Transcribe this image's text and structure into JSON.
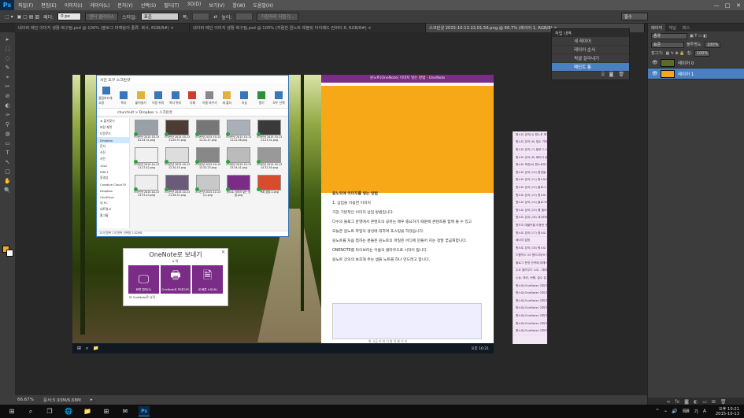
{
  "app": {
    "logo": "Ps"
  },
  "menu": [
    "파일(F)",
    "편집(E)",
    "이미지(I)",
    "레이어(L)",
    "문자(Y)",
    "선택(S)",
    "필터(T)",
    "3D(D)",
    "보기(V)",
    "창(W)",
    "도움말(H)"
  ],
  "window_controls": {
    "minimize": "—",
    "maximize": "□",
    "close": "✕"
  },
  "options": {
    "feather_label": "페더:",
    "feather_value": "0 px",
    "antialias_label": "앤티 앨리어스",
    "style_label": "스타일:",
    "style_value": "표준",
    "width_label": "폭:",
    "height_label": "높이:",
    "refine_button": "가장자리 다듬기...",
    "workspace": "필수"
  },
  "doc_tabs": [
    "네이버 메인 이미지 생활-복구됨.psd @ 100% (블로그 마케팅의 종류. 복사, RGB/8#) ×",
    "네이버 메인 이미지 생활-복구됨.psd @ 100% (저렴한 원노트 태블릿 아이패드 컨버터 8, RGB/8#) ×",
    "스크린샷 2015-10-13 22.01.56.png @ 66.7% (레이어 1, RGB/8) ×"
  ],
  "tools": [
    "▸",
    "⬚",
    "◌",
    "✎",
    "⌖",
    "✂",
    "⊘",
    "◐",
    "✑",
    "⚲",
    "◍",
    "▭",
    "T",
    "↖",
    "▢",
    "✋",
    "🔍"
  ],
  "history": {
    "title": "작업 내역",
    "items": [
      "새 레이어",
      "레이어 순서",
      "픽셀 잘라내기",
      "페인트 통"
    ],
    "selected": 3
  },
  "layers_panel": {
    "tabs": [
      "레이어",
      "채널",
      "패스"
    ],
    "kind_label": "종류",
    "blend_mode": "표준",
    "opacity_label": "불투명도:",
    "opacity_value": "100%",
    "lock_label": "잠그기:",
    "fill_label": "칠:",
    "fill_value": "100%",
    "layers": [
      {
        "name": "레이어 0",
        "thumb_color": "#5a6b2c",
        "selected": false
      },
      {
        "name": "레이어 1",
        "thumb_color": "#f7a817",
        "selected": true
      }
    ]
  },
  "explorer": {
    "title": "사진 도구   스크린샷",
    "ribbon": [
      "클립보드에 고정",
      "복사",
      "붙여넣기",
      "이동 위치",
      "복사 위치",
      "삭제",
      "이름 바꾸기",
      "새 폴더",
      "속성",
      "열기",
      "모두 선택"
    ],
    "address": "churchult > Dropbox > 스크린샷",
    "nav": [
      "★ 즐겨찾기",
      "바탕 화면",
      "다운로드",
      "Dropbox",
      "문서",
      "사진",
      "사진",
      "10s2",
      "WRL1",
      "동영상",
      "Creative Cloud Fil",
      "Dropbox",
      "OneDrive",
      "내 PC",
      "네트워크",
      "홈그룹"
    ],
    "files": [
      {
        "name": "스크린샷 2015-10-13 01.24.31.png",
        "color": "#9aa0a8"
      },
      {
        "name": "스크린샷 2015-10-13 11.09.37.png",
        "color": "#4c3c34"
      },
      {
        "name": "스크린샷 2015-10-13 11.22.47.png",
        "color": "#777777"
      },
      {
        "name": "스크린샷 2015-10-13 11.22.58.png",
        "color": "#aab0b8"
      },
      {
        "name": "스크린샷 2015-10-13 11.23.31.png",
        "color": "#3a3a3a"
      },
      {
        "name": "스크린샷 2015-10-13 11.27.42.png",
        "color": "#f0f0f0"
      },
      {
        "name": "스크린샷 2015-10-13 12.30.13.png",
        "color": "#dddddd"
      },
      {
        "name": "스크린샷 2015-10-13 13.52.23.png",
        "color": "#888888"
      },
      {
        "name": "스크린샷 2015-10-13 13.54.41.png",
        "color": "#bbbbbb"
      },
      {
        "name": "스크린샷 2015-10-13 14.32.30.png",
        "color": "#999999"
      },
      {
        "name": "스크린샷 2015-10-13 14.33.43.png",
        "color": "#eeeeee"
      },
      {
        "name": "스크린샷 2015-10-13 21.56.31.png",
        "color": "#6b5a7a"
      },
      {
        "name": "스크린샷 2015-10-13 (2).png",
        "color": "#c8c8c8"
      },
      {
        "name": "원노트 이미지 넣는 방법.png",
        "color": "#7b2c86"
      },
      {
        "name": "목록 검출-1.png",
        "color": "#d84b2c"
      }
    ],
    "status": "15개 항목 1개 항목 선택함 2.82MB"
  },
  "onenote_dialog": {
    "title": "OneNote로 보내기",
    "subtitle": "▸ 의",
    "tiles": [
      {
        "icon": "🖵",
        "label": "화면 캡처(S)"
      },
      {
        "icon": "🖶",
        "label": "OneNote로 보내기(P)"
      },
      {
        "icon": "🗎",
        "label": "새 빠른 노트(N)"
      }
    ],
    "checkbox": "OneNote로 시작",
    "close": "✕"
  },
  "onenote_window": {
    "top_title": "원노트(OneNote) 이미지 넣는 방법 - OneNote",
    "body": [
      "원노트에 이미지를 넣는 방법",
      "1. 삽입을 이용한 이미지",
      "가장 기본적인 이미지 삽입 방법입니다.",
      "다수의 블로그 운영에서 콘텐츠의 공유는 매우 중요하기 때문에 콘텐츠를 함께 볼 수 있고",
      "오늘은 원노트 파일의 생성에 대하여 포스팅을 하겠습니다.",
      "원노트를 처음 접하는 분들은 원노트의 파일은 어디에 만들어 지는 정말 궁금해합니다.",
      "ONENOTE를 타이브러는 이름의 클라우드로 시작이 됩니다.",
      "원노트 강의의 보조해 주는 샘플 노트를 하나 만드려고 합니다."
    ],
    "pages": [
      "원노트 강의(4) 원노트 파일의",
      "원노트 강의 (6) 필수 기타 원",
      "원노트 강의 (7) 블로그 API",
      "원노트 강의 (8) 페이지 분류",
      "원노트 독립(9) 원노트와 블로",
      "원노트 강의 (10) 협업을 위한",
      "원노트 강의 (11) 원노트의 검",
      "원노트 강의 (12) 블로그 API",
      "원노트 강의 (13) 원노트 블로",
      "원노트 강의 (14) 블로그에 원",
      "원노트 강의 (15) 웹 클리퍼 블",
      "원노트 강의 (16) 데이터베이스",
      "원드오 태블릿을 이용한 원노",
      "원노트 강의 (17) 원노트 필기",
      "페이지 없음",
      "원노트 강의 (18) 원노트 웹",
      "드롭박스 VS 원드라이브 당신",
      "블로그 운영 전략에 대해서",
      "주요 클라우드 노트 - 에버노트",
      "수능, 해외, 여행, 필수 절 스",
      "원노트(OneNote) 이미지(13-1)",
      "원노트(OneNote) 이미지(13-2)",
      "원노트(OneNote) 이미지(13-3)",
      "원노트(OneNote) 이미지(13-4)",
      "원노트(OneNote) 이미지(13-5)",
      "원노트(OneNote) 이미지(13-6)",
      "원노트(OneNote) 이미지(13-7)"
    ],
    "caption": "화 고급 라 대 기 발 의 페 이 지 ",
    "clock": "오후 10:21"
  },
  "statusbar": {
    "zoom": "66.67%",
    "doc": "문서:5.93M/6.68M",
    "arrow": "▸"
  },
  "taskbar": {
    "icons": [
      "⊞",
      "⌕",
      "❐",
      "🌐",
      "📁",
      "⊞",
      "✉",
      "Ps"
    ],
    "tray": [
      "^",
      "⌁",
      "🔊",
      "⌨",
      "가",
      "A"
    ],
    "time": "오후 10:21",
    "date": "2015-10-13"
  }
}
